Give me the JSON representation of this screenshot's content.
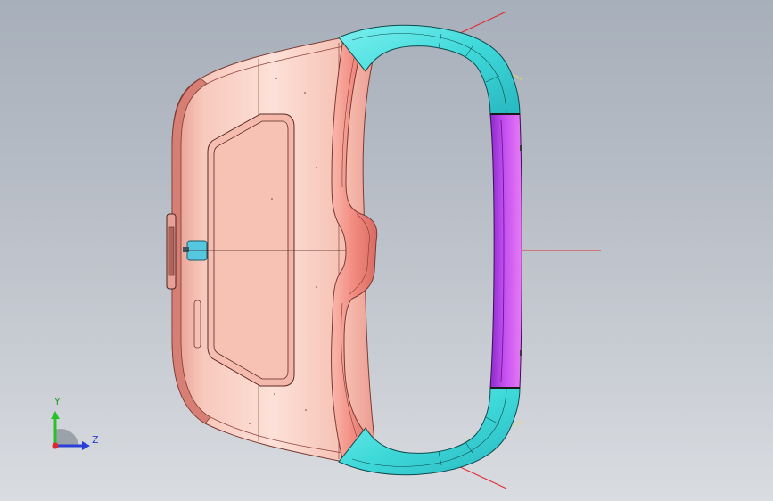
{
  "triad": {
    "y_label": "Y",
    "z_label": "Z"
  },
  "colors": {
    "background_top": "#a7afba",
    "background_bottom": "#d9dce0",
    "housing": "#f7c4b8",
    "housing_edge": "#c9675c",
    "frame_cyan": "#3fd9d9",
    "frame_pink": "#f08080",
    "strap_magenta": "#c13fe6",
    "button_cyan": "#55c8e0",
    "axis_red": "#e0282d",
    "axis_yellow": "#e0e05a"
  }
}
